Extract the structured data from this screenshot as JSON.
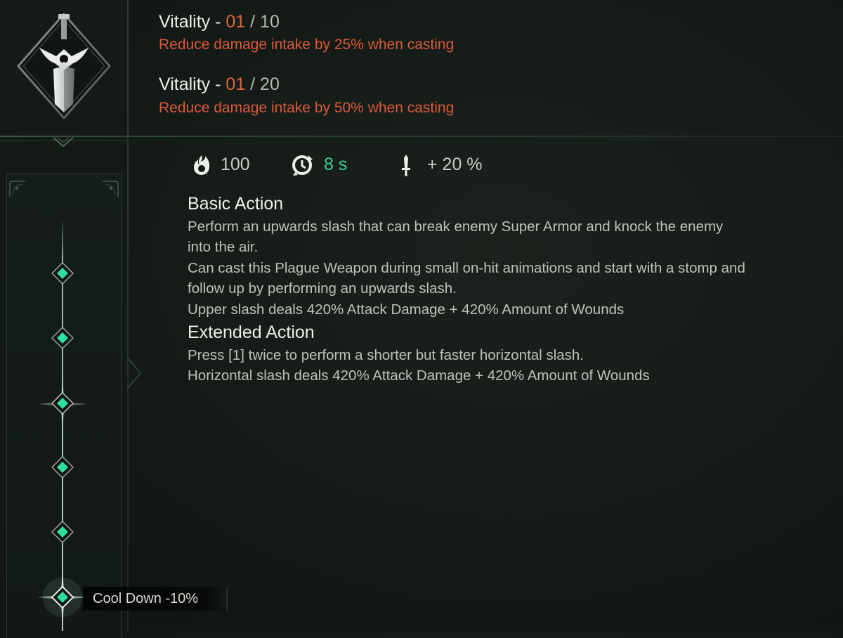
{
  "header": {
    "vitality_1": {
      "label": "Vitality - ",
      "current": "01",
      "max": " / 10",
      "desc": "Reduce damage intake by 25% when casting"
    },
    "vitality_2": {
      "label": "Vitality - ",
      "current": "01",
      "max": " / 20",
      "desc": "Reduce damage intake by 50% when casting"
    }
  },
  "stats": {
    "cost": "100",
    "cooldown": "8 s",
    "bonus": "+ 20 %",
    "cost_icon": "flame-icon",
    "cooldown_icon": "cooldown-clock-icon",
    "bonus_icon": "dagger-icon",
    "cooldown_color": "#3fcf97"
  },
  "basic_action": {
    "title": "Basic Action",
    "lines": [
      "Perform an upwards slash that can break enemy Super Armor and knock the enemy",
      "into the air.",
      "Can cast this Plague Weapon during small on-hit animations and start with a stomp and",
      "follow up by performing an upwards slash.",
      "Upper slash deals 420% Attack Damage + 420% Amount of Wounds"
    ]
  },
  "extended_action": {
    "title": "Extended Action",
    "lines": [
      "Press [1] twice to perform a shorter but faster horizontal slash.",
      "Horizontal slash deals 420% Attack Damage + 420% Amount of Wounds"
    ]
  },
  "skill_tree": {
    "node_label": "Cool Down -10%",
    "node_count": 6,
    "node_color": "#2ee0a0",
    "weapon_icon": "greatsword-icon"
  },
  "colors": {
    "accent_orange": "#e0663e",
    "desc_red": "#d85a3a",
    "teal": "#3fcf97"
  }
}
